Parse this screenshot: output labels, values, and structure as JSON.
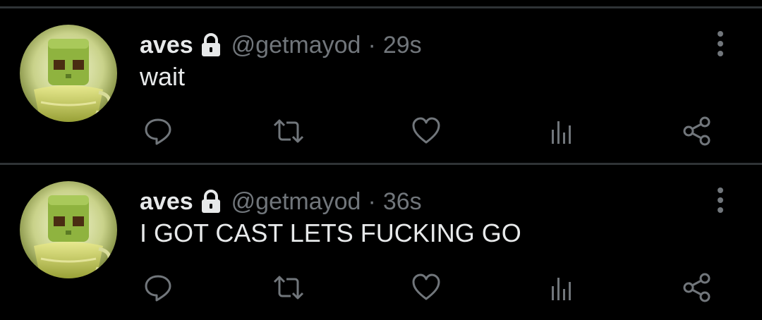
{
  "colors": {
    "background": "#000000",
    "text_primary": "#e7e9ea",
    "text_secondary": "#71767b",
    "divider": "#2f3336",
    "icon": "#71767b"
  },
  "tweets": [
    {
      "display_name": "aves",
      "handle": "@getmayod",
      "separator": "·",
      "time": "29s",
      "text": "wait",
      "protected": true
    },
    {
      "display_name": "aves",
      "handle": "@getmayod",
      "separator": "·",
      "time": "36s",
      "text": "I GOT CAST LETS FUCKING GO",
      "protected": true
    }
  ],
  "icons": {
    "more": "more-vertical-icon",
    "reply": "reply-icon",
    "retweet": "retweet-icon",
    "like": "heart-icon",
    "stats": "analytics-icon",
    "share": "share-icon",
    "lock": "lock-icon"
  }
}
